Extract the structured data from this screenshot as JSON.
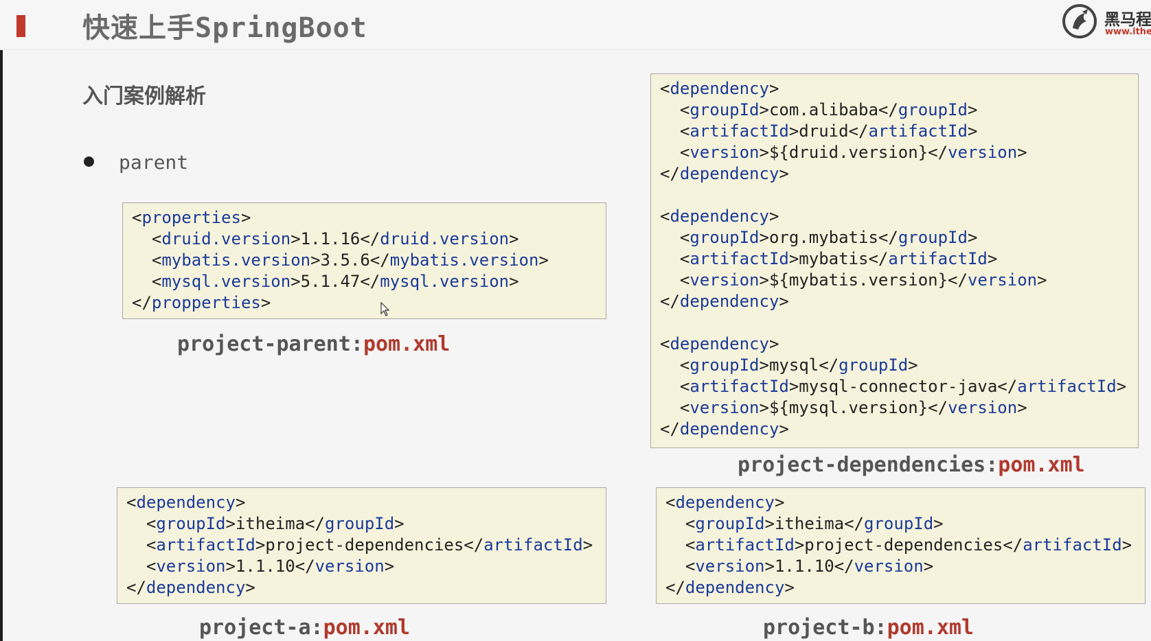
{
  "header": {
    "title": "快速上手SpringBoot",
    "logo_cn": "黑马程",
    "logo_url": "www.ithein",
    "accent_color": "#c0392b"
  },
  "section_title": "入门案例解析",
  "bullet": "parent",
  "boxes": {
    "parent": {
      "lines": [
        [
          "<",
          "properties",
          ">"
        ],
        [
          "  <",
          "druid.version",
          ">1.1.16</",
          "druid.version",
          ">"
        ],
        [
          "  <",
          "mybatis.version",
          ">3.5.6</",
          "mybatis.version",
          ">"
        ],
        [
          "  <",
          "mysql.version",
          ">5.1.47</",
          "mysql.version",
          ">"
        ],
        [
          "</",
          "propperties",
          ">"
        ]
      ],
      "caption_name": "project-parent:",
      "caption_file": "pom.xml"
    },
    "dependencies": {
      "lines": [
        [
          "<",
          "dependency",
          ">"
        ],
        [
          "  <",
          "groupId",
          ">com.alibaba</",
          "groupId",
          ">"
        ],
        [
          "  <",
          "artifactId",
          ">druid</",
          "artifactId",
          ">"
        ],
        [
          "  <",
          "version",
          ">${druid.version}</",
          "version",
          ">"
        ],
        [
          "</",
          "dependency",
          ">"
        ],
        [
          ""
        ],
        [
          "<",
          "dependency",
          ">"
        ],
        [
          "  <",
          "groupId",
          ">org.mybatis</",
          "groupId",
          ">"
        ],
        [
          "  <",
          "artifactId",
          ">mybatis</",
          "artifactId",
          ">"
        ],
        [
          "  <",
          "version",
          ">${mybatis.version}</",
          "version",
          ">"
        ],
        [
          "</",
          "dependency",
          ">"
        ],
        [
          ""
        ],
        [
          "<",
          "dependency",
          ">"
        ],
        [
          "  <",
          "groupId",
          ">mysql</",
          "groupId",
          ">"
        ],
        [
          "  <",
          "artifactId",
          ">mysql-connector-java</",
          "artifactId",
          ">"
        ],
        [
          "  <",
          "version",
          ">${mysql.version}</",
          "version",
          ">"
        ],
        [
          "</",
          "dependency",
          ">"
        ]
      ],
      "caption_name": "project-dependencies:",
      "caption_file": "pom.xml"
    },
    "project_a": {
      "lines": [
        [
          "<",
          "dependency",
          ">"
        ],
        [
          "  <",
          "groupId",
          ">itheima</",
          "groupId",
          ">"
        ],
        [
          "  <",
          "artifactId",
          ">project-dependencies</",
          "artifactId",
          ">"
        ],
        [
          "  <",
          "version",
          ">1.1.10</",
          "version",
          ">"
        ],
        [
          "</",
          "dependency",
          ">"
        ]
      ],
      "caption_name": "project-a:",
      "caption_file": "pom.xml"
    },
    "project_b": {
      "lines": [
        [
          "<",
          "dependency",
          ">"
        ],
        [
          "  <",
          "groupId",
          ">itheima</",
          "groupId",
          ">"
        ],
        [
          "  <",
          "artifactId",
          ">project-dependencies</",
          "artifactId",
          ">"
        ],
        [
          "  <",
          "version",
          ">1.1.10</",
          "version",
          ">"
        ],
        [
          "</",
          "dependency",
          ">"
        ]
      ],
      "caption_name": "project-b:",
      "caption_file": "pom.xml"
    }
  },
  "colors": {
    "tag": "#1a3a99",
    "code_bg": "#f6f3dc",
    "file_name": "#b03a2e"
  }
}
